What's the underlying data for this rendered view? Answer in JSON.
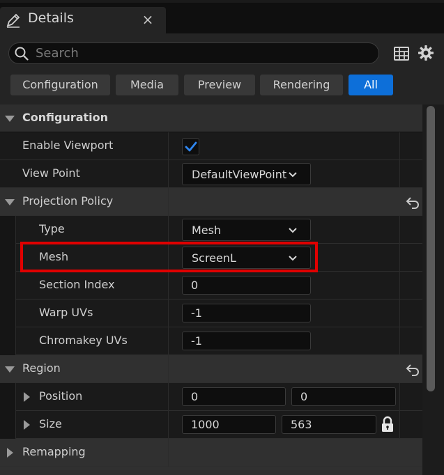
{
  "tab": {
    "title": "Details",
    "close": "×"
  },
  "search": {
    "placeholder": "Search"
  },
  "filters": [
    "Configuration",
    "Media",
    "Preview",
    "Rendering",
    "All"
  ],
  "active_filter": "All",
  "sections": {
    "configuration": "Configuration",
    "projection_policy": "Projection Policy",
    "region": "Region",
    "remapping": "Remapping"
  },
  "properties": {
    "enable_viewport": {
      "label": "Enable Viewport",
      "checked": true
    },
    "view_point": {
      "label": "View Point",
      "value": "DefaultViewPoint"
    },
    "type": {
      "label": "Type",
      "value": "Mesh"
    },
    "mesh": {
      "label": "Mesh",
      "value": "ScreenL"
    },
    "section_index": {
      "label": "Section Index",
      "value": "0"
    },
    "warp_uvs": {
      "label": "Warp UVs",
      "value": "-1"
    },
    "chromakey_uvs": {
      "label": "Chromakey UVs",
      "value": "-1"
    },
    "position": {
      "label": "Position",
      "x": "0",
      "y": "0"
    },
    "size": {
      "label": "Size",
      "w": "1000",
      "h": "563"
    }
  },
  "colors": {
    "accent": "#0d6fd9",
    "highlight": "#e00000",
    "background": "#242424"
  },
  "icons": [
    "pencil-icon",
    "search-icon",
    "table-icon",
    "gear-icon",
    "reset-arrow-icon",
    "lock-icon",
    "chevron-down-icon",
    "checkmark-icon"
  ]
}
